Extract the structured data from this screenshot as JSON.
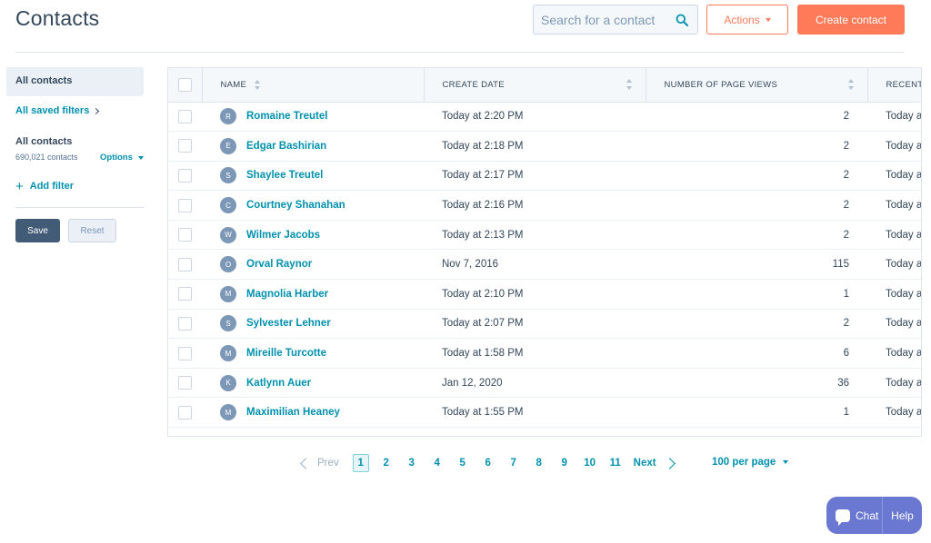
{
  "header": {
    "title": "Contacts",
    "search_placeholder": "Search for a contact",
    "actions_label": "Actions",
    "create_label": "Create contact"
  },
  "sidebar": {
    "all_contacts": "All contacts",
    "saved_filters": "All saved filters",
    "view_name": "All contacts",
    "view_count": "690,021 contacts",
    "options_label": "Options",
    "add_filter": "Add filter",
    "save_label": "Save",
    "reset_label": "Reset"
  },
  "table": {
    "columns": [
      "NAME",
      "CREATE DATE",
      "NUMBER OF PAGE VIEWS",
      "RECENT"
    ],
    "rows": [
      {
        "initial": "R",
        "name": "Romaine Treutel",
        "create_date": "Today at 2:20 PM",
        "page_views": "2",
        "recent": "Today at"
      },
      {
        "initial": "E",
        "name": "Edgar Bashirian",
        "create_date": "Today at 2:18 PM",
        "page_views": "2",
        "recent": "Today at"
      },
      {
        "initial": "S",
        "name": "Shaylee Treutel",
        "create_date": "Today at 2:17 PM",
        "page_views": "2",
        "recent": "Today at"
      },
      {
        "initial": "C",
        "name": "Courtney Shanahan",
        "create_date": "Today at 2:16 PM",
        "page_views": "2",
        "recent": "Today at"
      },
      {
        "initial": "W",
        "name": "Wilmer Jacobs",
        "create_date": "Today at 2:13 PM",
        "page_views": "2",
        "recent": "Today at"
      },
      {
        "initial": "O",
        "name": "Orval Raynor",
        "create_date": "Nov 7, 2016",
        "page_views": "115",
        "recent": "Today at"
      },
      {
        "initial": "M",
        "name": "Magnolia Harber",
        "create_date": "Today at 2:10 PM",
        "page_views": "1",
        "recent": "Today at"
      },
      {
        "initial": "S",
        "name": "Sylvester Lehner",
        "create_date": "Today at 2:07 PM",
        "page_views": "2",
        "recent": "Today at"
      },
      {
        "initial": "M",
        "name": "Mireille Turcotte",
        "create_date": "Today at 1:58 PM",
        "page_views": "6",
        "recent": "Today at"
      },
      {
        "initial": "K",
        "name": "Katlynn Auer",
        "create_date": "Jan 12, 2020",
        "page_views": "36",
        "recent": "Today at"
      },
      {
        "initial": "M",
        "name": "Maximilian Heaney",
        "create_date": "Today at 1:55 PM",
        "page_views": "1",
        "recent": "Today at"
      }
    ]
  },
  "pagination": {
    "prev_label": "Prev",
    "next_label": "Next",
    "pages": [
      "1",
      "2",
      "3",
      "4",
      "5",
      "6",
      "7",
      "8",
      "9",
      "10",
      "11"
    ],
    "current": "1",
    "per_page": "100 per page"
  },
  "chat": {
    "chat_label": "Chat",
    "help_label": "Help"
  },
  "colors": {
    "accent": "#ff7a59",
    "link": "#0091ae",
    "text": "#33475b",
    "chat": "#6a78d1"
  }
}
